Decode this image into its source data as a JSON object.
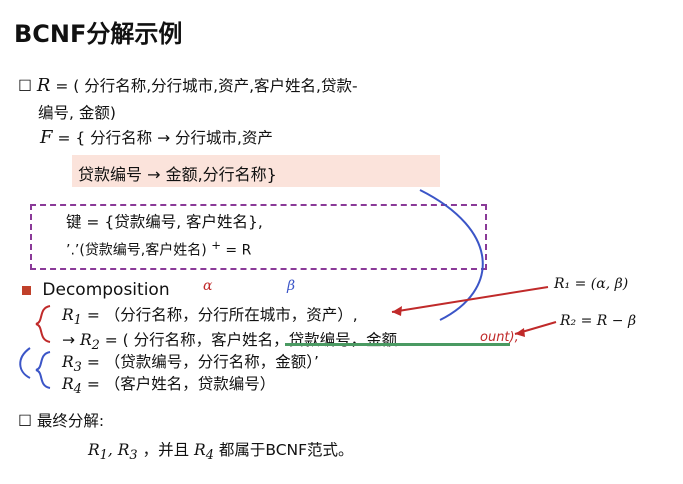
{
  "title": "BCNF分解示例",
  "r_line1": "( 分行名称,分行城市,资产,客户姓名,贷款-",
  "r_line2": "编号, 金额)",
  "f_line1": "{ 分行名称 → 分行城市,资产",
  "f_line2": "贷款编号 → 金额,分行名称}",
  "key_line": "键 = {贷款编号, 客户姓名},",
  "closure_line": "’.’(贷款编号,客户姓名)",
  "closure_rhs": "= R",
  "decomposition_label": "Decomposition",
  "alpha": "α",
  "beta": "β",
  "r1_text": "（分行名称，分行所在城市，资产）,",
  "r2_text": "( 分行名称，客户姓名，贷款编号，金额",
  "r2_tail": "ount),",
  "r3_text": "（贷款编号，分行名称，金额）’",
  "r4_text": "（客户姓名，贷款编号）",
  "ann_r1": "R₁ = (α, β)",
  "ann_r2": "R₂ = R − β",
  "final_label": "最终分解:",
  "final_text": "，并且",
  "final_tail": "都属于BCNF范式。",
  "colors": {
    "highlight": "#fbe3db",
    "dashed_box": "#8a3a98",
    "red": "#c02a2a",
    "blue": "#3b55c7",
    "green": "#4a9a62"
  }
}
